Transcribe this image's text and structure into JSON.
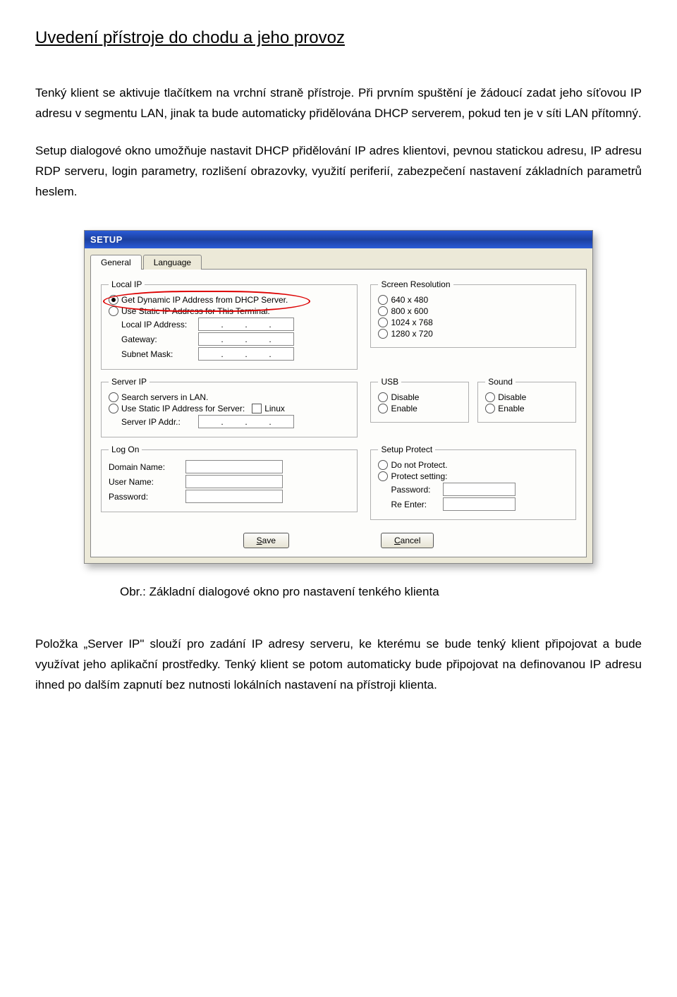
{
  "doc": {
    "heading": "Uvedení přístroje do chodu a jeho provoz",
    "para1": "Tenký klient se aktivuje tlačítkem na vrchní straně přístroje. Při prvním spuštění je žádoucí zadat jeho síťovou IP adresu v segmentu LAN, jinak ta bude automaticky přidělována DHCP serverem, pokud ten je v síti LAN přítomný.",
    "para2": "Setup dialogové okno umožňuje nastavit DHCP přidělování IP adres klientovi, pevnou statickou adresu, IP adresu RDP serveru, login parametry, rozlišení obrazovky, využití periferií, zabezpečení nastavení základních parametrů heslem.",
    "caption": "Obr.: Základní dialogové okno pro nastavení tenkého klienta",
    "para3": "Položka „Server IP\" slouží pro zadání IP adresy serveru, ke kterému se bude tenký klient připojovat a bude využívat jeho aplikační prostředky. Tenký klient se potom automaticky bude připojovat na definovanou IP adresu ihned po dalším zapnutí bez nutnosti lokálních nastavení na přístroji klienta."
  },
  "window": {
    "title": "SETUP",
    "tabs": {
      "general": "General",
      "language": "Language"
    },
    "local_ip": {
      "legend": "Local IP",
      "opt_dhcp": "Get Dynamic IP Address from DHCP Server.",
      "opt_static": "Use Static IP Address for This Terminal:",
      "lbl_local_ip": "Local IP Address:",
      "lbl_gateway": "Gateway:",
      "lbl_subnet": "Subnet Mask:"
    },
    "screen": {
      "legend": "Screen Resolution",
      "r1": "640 x 480",
      "r2": "800 x 600",
      "r3": "1024 x 768",
      "r4": "1280 x 720"
    },
    "server_ip": {
      "legend": "Server IP",
      "opt_search": "Search servers in LAN.",
      "opt_static": "Use Static IP Address for Server:",
      "chk_linux": "Linux",
      "lbl_addr": "Server IP Addr.:"
    },
    "usb": {
      "legend": "USB",
      "disable": "Disable",
      "enable": "Enable"
    },
    "sound": {
      "legend": "Sound",
      "disable": "Disable",
      "enable": "Enable"
    },
    "logon": {
      "legend": "Log On",
      "lbl_domain": "Domain Name:",
      "lbl_user": "User Name:",
      "lbl_pass": "Password:"
    },
    "protect": {
      "legend": "Setup Protect",
      "opt_no": "Do not Protect.",
      "opt_yes": "Protect setting:",
      "lbl_pass": "Password:",
      "lbl_re": "Re Enter:"
    },
    "buttons": {
      "save_s": "S",
      "save_rest": "ave",
      "cancel_c": "C",
      "cancel_rest": "ancel"
    }
  }
}
